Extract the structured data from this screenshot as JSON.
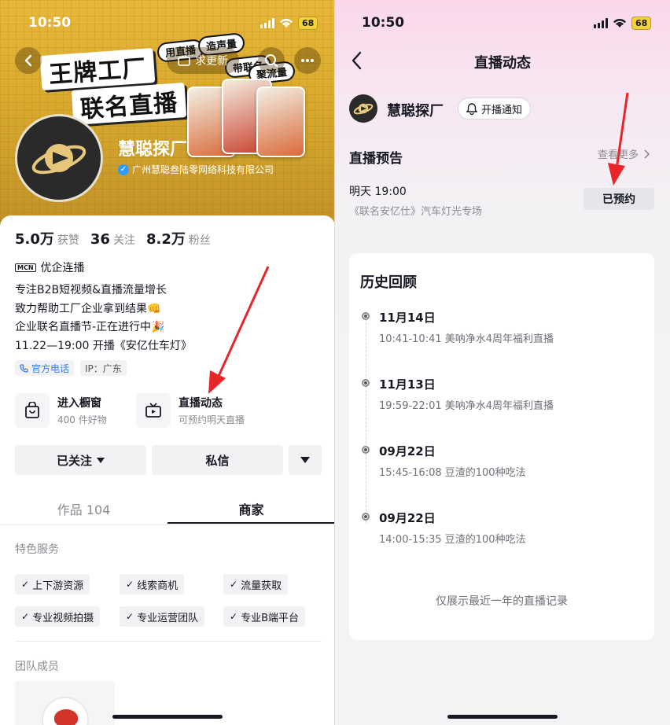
{
  "left": {
    "status": {
      "time": "10:50",
      "battery": "68"
    },
    "banner": {
      "title_line1": "王牌工厂",
      "title_line2": "联名直播",
      "bubble1": "用直播",
      "bubble2": "造声量",
      "bubble3": "带联名",
      "bubble4": "聚流量",
      "update_label": "求更新"
    },
    "profile": {
      "name": "慧聪探厂",
      "company": "广州慧聪叁陆零网络科技有限公司"
    },
    "stats": [
      {
        "num": "5.0万",
        "label": "获赞"
      },
      {
        "num": "36",
        "label": "关注"
      },
      {
        "num": "8.2万",
        "label": "粉丝"
      }
    ],
    "mcn": {
      "logo": "MCN",
      "label": "优企连播"
    },
    "bio": [
      "专注B2B短视频&直播流量增长",
      "致力帮助工厂企业拿到结果👊",
      "企业联名直播节-正在进行中🎉",
      "11.22—19:00 开播《安亿仕车灯》"
    ],
    "chips": {
      "phone": "官方电话",
      "ip": "IP：广东"
    },
    "entries": {
      "window_title": "进入橱窗",
      "window_sub": "400 件好物",
      "live_title": "直播动态",
      "live_sub": "可预约明天直播"
    },
    "buttons": {
      "follow": "已关注",
      "message": "私信"
    },
    "tabs": {
      "works": "作品 104",
      "shop": "商家"
    },
    "services": {
      "title": "特色服务",
      "items": [
        "上下游资源",
        "线索商机",
        "流量获取",
        "专业视频拍摄",
        "专业运营团队",
        "专业B端平台"
      ]
    },
    "team": {
      "title": "团队成员"
    }
  },
  "right": {
    "status": {
      "time": "10:50",
      "battery": "68"
    },
    "title": "直播动态",
    "account": {
      "name": "慧聪探厂",
      "notify": "开播通知"
    },
    "preview": {
      "title": "直播预告",
      "see_more": "查看更多",
      "time": "明天 19:00",
      "subject": "《联名安亿仕》汽车灯光专场",
      "booked": "已预约"
    },
    "history": {
      "title": "历史回顾",
      "items": [
        {
          "date": "11月14日",
          "desc": "10:41-10:41 美呐净水4周年福利直播"
        },
        {
          "date": "11月13日",
          "desc": "19:59-22:01 美呐净水4周年福利直播"
        },
        {
          "date": "09月22日",
          "desc": "15:45-16:08 豆渣的100种吃法"
        },
        {
          "date": "09月22日",
          "desc": "14:00-15:35 豆渣的100种吃法"
        }
      ],
      "footer": "仅展示最近一年的直播记录"
    }
  },
  "colors": {
    "banner": "#e0b035",
    "arrow": "#e8262a",
    "verified": "#2f9bff",
    "link_blue": "#2e7cf6"
  }
}
